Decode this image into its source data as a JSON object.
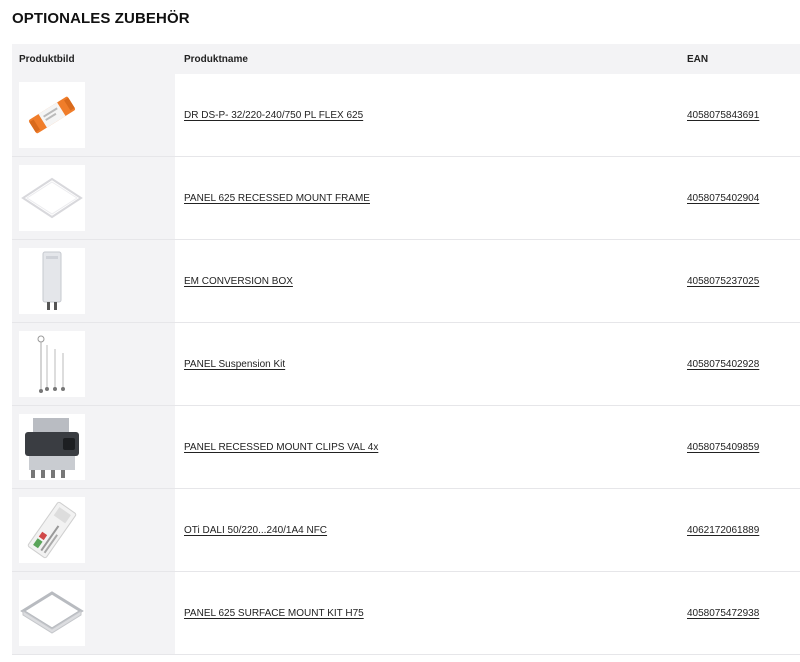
{
  "title": "OPTIONALES ZUBEHÖR",
  "columns": {
    "image": "Produktbild",
    "name": "Produktname",
    "ean": "EAN"
  },
  "rows": [
    {
      "name": "DR DS-P- 32/220-240/750 PL FLEX 625",
      "ean": "4058075843691",
      "icon": "driver-icon"
    },
    {
      "name": "PANEL 625 RECESSED MOUNT FRAME",
      "ean": "4058075402904",
      "icon": "frame-icon"
    },
    {
      "name": "EM CONVERSION BOX",
      "ean": "4058075237025",
      "icon": "conversion-box-icon"
    },
    {
      "name": "PANEL Suspension Kit",
      "ean": "4058075402928",
      "icon": "suspension-kit-icon"
    },
    {
      "name": "PANEL RECESSED MOUNT CLIPS VAL 4x",
      "ean": "4058075409859",
      "icon": "mount-clips-icon"
    },
    {
      "name": "OTi DALI 50/220...240/1A4 NFC",
      "ean": "4062172061889",
      "icon": "dali-driver-icon"
    },
    {
      "name": "PANEL 625 SURFACE MOUNT KIT H75",
      "ean": "4058075472938",
      "icon": "surface-mount-kit-icon"
    }
  ],
  "colors": {
    "header_bg": "#f3f3f5",
    "accent_orange": "#f07d2a"
  }
}
